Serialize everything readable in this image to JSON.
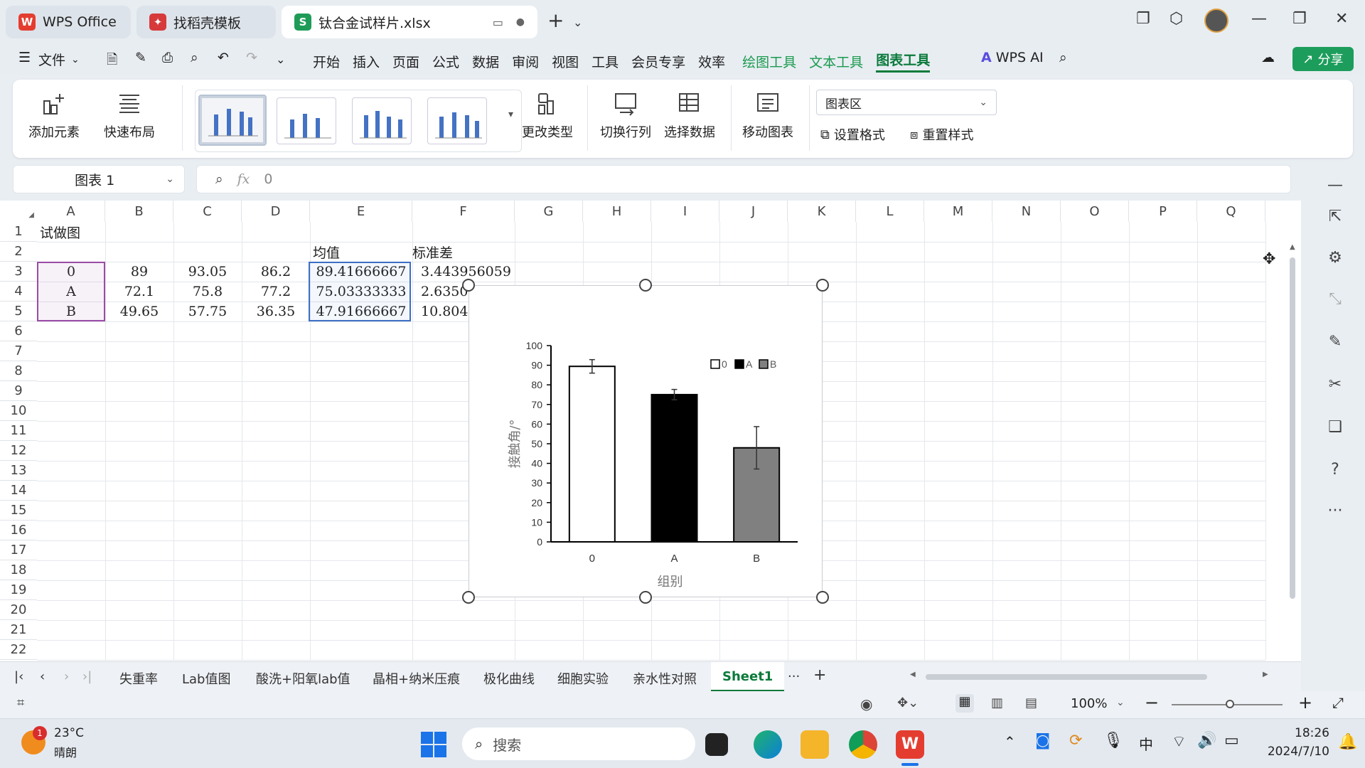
{
  "titlebar": {
    "tabs": [
      {
        "label": "WPS Office",
        "icon": "wps-logo-icon"
      },
      {
        "label": "找稻壳模板",
        "icon": "docer-icon"
      },
      {
        "label": "钛合金试样片.xlsx",
        "icon": "spreadsheet-icon"
      }
    ]
  },
  "menu": {
    "file": "文件",
    "items": [
      "开始",
      "插入",
      "页面",
      "公式",
      "数据",
      "审阅",
      "视图",
      "工具",
      "会员专享",
      "效率"
    ],
    "context_tabs": [
      "绘图工具",
      "文本工具"
    ],
    "active_tab": "图表工具",
    "wps_ai": "WPS AI",
    "share": "分享"
  },
  "ribbon": {
    "add_element": "添加元素",
    "quick_layout": "快速布局",
    "change_type": "更改类型",
    "switch_row_col": "切换行列",
    "select_data": "选择数据",
    "move_chart": "移动图表",
    "chart_area_select": "图表区",
    "set_format": "设置格式",
    "reset_style": "重置样式"
  },
  "formula_bar": {
    "name_box": "图表 1",
    "fx": "fx",
    "value": "0"
  },
  "grid": {
    "columns": [
      "A",
      "B",
      "C",
      "D",
      "E",
      "F",
      "G",
      "H",
      "I",
      "J",
      "K",
      "L",
      "M",
      "N",
      "O",
      "P",
      "Q"
    ],
    "rows": [
      "1",
      "2",
      "3",
      "4",
      "5",
      "6",
      "7",
      "8",
      "9",
      "10",
      "11",
      "12",
      "13",
      "14",
      "15",
      "16",
      "17",
      "18",
      "19",
      "20",
      "21",
      "22"
    ],
    "a1": "试做图",
    "e2": "均值",
    "f2": "标准差",
    "data_rows": [
      {
        "a": "0",
        "b": "89",
        "c": "93.05",
        "d": "86.2",
        "e": "89.41666667",
        "f": "3.443956059"
      },
      {
        "a": "A",
        "b": "72.1",
        "c": "75.8",
        "d": "77.2",
        "e": "75.03333333",
        "f": "2.6350"
      },
      {
        "a": "B",
        "b": "49.65",
        "c": "57.75",
        "d": "36.35",
        "e": "47.91666667",
        "f": "10.804"
      }
    ]
  },
  "chart_data": {
    "type": "bar",
    "categories": [
      "0",
      "A",
      "B"
    ],
    "values": [
      89.42,
      75.03,
      47.92
    ],
    "errors": [
      3.44,
      2.64,
      10.8
    ],
    "bar_colors": [
      "#ffffff",
      "#000000",
      "#808080"
    ],
    "legend": [
      "0",
      "A",
      "B"
    ],
    "legend_position": "top-right",
    "xlabel": "组别",
    "ylabel": "接触角/°",
    "ylim": [
      0,
      100
    ],
    "yticks": [
      "0",
      "10",
      "20",
      "30",
      "40",
      "50",
      "60",
      "70",
      "80",
      "90",
      "100"
    ],
    "grid": false
  },
  "sheets": {
    "tabs": [
      "失重率",
      "Lab值图",
      "酸洗+阳氧lab值",
      "晶相+纳米压痕",
      "极化曲线",
      "细胞实验",
      "亲水性对照"
    ],
    "active": "Sheet1",
    "more": "···"
  },
  "status": {
    "zoom": "100%"
  },
  "taskbar": {
    "weather_temp": "23°C",
    "weather_text": "晴朗",
    "weather_badge": "1",
    "search_placeholder": "搜索",
    "ime": "中",
    "time": "18:26",
    "date": "2024/7/10"
  }
}
